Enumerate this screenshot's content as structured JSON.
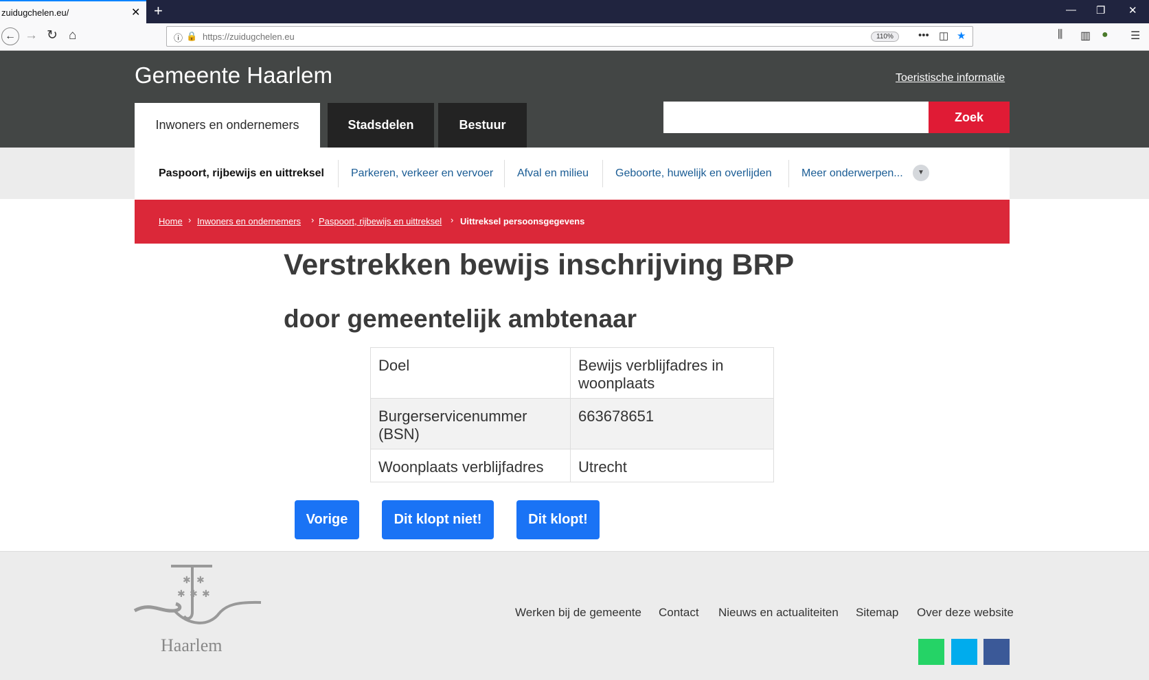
{
  "browser": {
    "tab_title": "zuidugchelen.eu/",
    "tab_close": "✕",
    "new_tab": "+",
    "url": "https://zuidugchelen.eu",
    "zoom": "110%",
    "page_actions": "•••"
  },
  "header": {
    "site_title": "Gemeente Haarlem",
    "tourist_link": "Toeristische informatie",
    "tabs": [
      {
        "label": "Inwoners en ondernemers"
      },
      {
        "label": "Stadsdelen"
      },
      {
        "label": "Bestuur"
      }
    ],
    "search_value": "",
    "search_button": "Zoek"
  },
  "subnav": {
    "items": [
      {
        "label": "Paspoort, rijbewijs en uittreksel"
      },
      {
        "label": "Parkeren, verkeer en vervoer"
      },
      {
        "label": "Afval en milieu"
      },
      {
        "label": "Geboorte, huwelijk en overlijden"
      },
      {
        "label": "Meer onderwerpen..."
      }
    ]
  },
  "breadcrumb": {
    "items": [
      {
        "label": "Home"
      },
      {
        "label": "Inwoners en ondernemers"
      },
      {
        "label": "Paspoort, rijbewijs en uittreksel"
      },
      {
        "label": "Uittreksel persoonsgegevens"
      }
    ],
    "separator": "›"
  },
  "main": {
    "title": "Verstrekken bewijs inschrijving BRP",
    "subtitle": "door gemeentelijk ambtenaar",
    "table": [
      {
        "label": "Doel",
        "value": "Bewijs verblijfadres in woonplaats"
      },
      {
        "label": "Burgerservicenummer (BSN)",
        "value": "663678651"
      },
      {
        "label": "Woonplaats verblijfadres",
        "value": "Utrecht"
      }
    ],
    "buttons": {
      "previous": "Vorige",
      "incorrect": "Dit klopt niet!",
      "correct": "Dit klopt!"
    }
  },
  "footer": {
    "logo_text": "Haarlem",
    "links": [
      {
        "label": "Werken bij de gemeente"
      },
      {
        "label": "Contact"
      },
      {
        "label": "Nieuws en actualiteiten"
      },
      {
        "label": "Sitemap"
      },
      {
        "label": "Over deze website"
      }
    ],
    "social": [
      {
        "icon": "whatsapp-icon",
        "color": "#25d366"
      },
      {
        "icon": "twitter-icon",
        "color": "#00aced"
      },
      {
        "icon": "facebook-icon",
        "color": "#3b5998"
      }
    ]
  },
  "colors": {
    "header_bg": "#434645",
    "accent_red": "#db2839",
    "button_blue": "#1a73f5"
  }
}
